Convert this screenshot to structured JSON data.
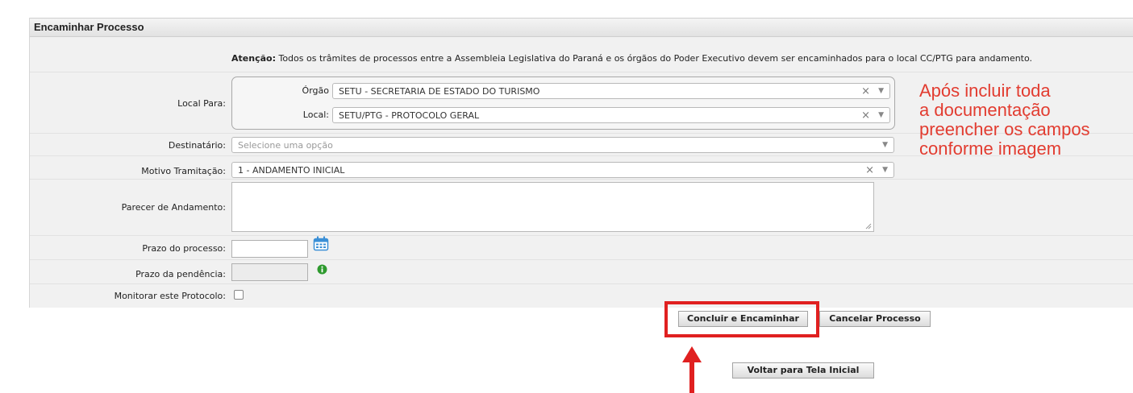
{
  "panel": {
    "title": "Encaminhar Processo"
  },
  "attention": {
    "bold": "Atenção:",
    "text": " Todos os trâmites de processos entre a Assembleia Legislativa do Paraná e os órgãos do Poder Executivo devem ser encaminhados para o local CC/PTG para andamento."
  },
  "form": {
    "local_para_label": "Local Para:",
    "orgao_label": "Órgão",
    "orgao_value": "SETU - SECRETARIA DE ESTADO DO TURISMO",
    "local_label": "Local:",
    "local_value": "SETU/PTG - PROTOCOLO GERAL",
    "destinatario_label": "Destinatário:",
    "destinatario_placeholder": "Selecione uma opção",
    "motivo_label": "Motivo Tramitação:",
    "motivo_value": "1 - ANDAMENTO INICIAL",
    "parecer_label": "Parecer de Andamento:",
    "prazo_processo_label": "Prazo do processo:",
    "prazo_pendencia_label": "Prazo da pendência:",
    "monitorar_label": "Monitorar este Protocolo:",
    "clear_glyph": "×",
    "arrow_glyph": "▼"
  },
  "buttons": {
    "concluir": "Concluir e Encaminhar",
    "cancelar": "Cancelar Processo",
    "voltar": "Voltar para Tela Inicial"
  },
  "annotation": {
    "lines": [
      "Após incluir toda",
      "a documentação",
      "preencher os campos",
      "conforme imagem"
    ],
    "color": "#e23c30"
  },
  "colors": {
    "panel_bg": "#f1f1f1",
    "highlight": "#e02020",
    "calendar_icon": "#3a8fd6",
    "info_icon": "#2e9a2e"
  }
}
